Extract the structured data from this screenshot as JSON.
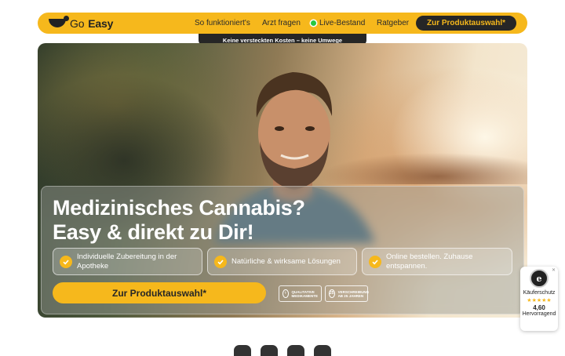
{
  "nav": {
    "logo_prefix": "Go",
    "logo_suffix": "Easy",
    "links": [
      "So funktioniert's",
      "Arzt fragen",
      "Live-Bestand",
      "Ratgeber"
    ],
    "cta_label": "Zur Produktauswahl*"
  },
  "banner": {
    "text": "Keine versteckten Kosten – keine Umwege"
  },
  "hero": {
    "headline_line1": "Medizinisches Cannabis?",
    "headline_line2": "Easy & direkt zu Dir!",
    "features": [
      "Individuelle Zubereitung in der Apotheke",
      "Natürliche & wirksame Lösungen",
      "Online bestellen. Zuhause entspannen."
    ],
    "cta_label": "Zur Produktauswahl*",
    "badges": [
      {
        "line1": "QUALITATIVE",
        "line2": "MEDIKAMENTE"
      },
      {
        "line1": "VERSCHREIBUNG",
        "line2": "AB 25 JAHREN"
      }
    ]
  },
  "trust": {
    "label": "Käuferschutz",
    "stars": "★★★★★",
    "rating": "4,60",
    "rating_text": "Hervorragend"
  },
  "colors": {
    "brand_yellow": "#f6b81c",
    "dark": "#262626",
    "live_green": "#28c840"
  }
}
